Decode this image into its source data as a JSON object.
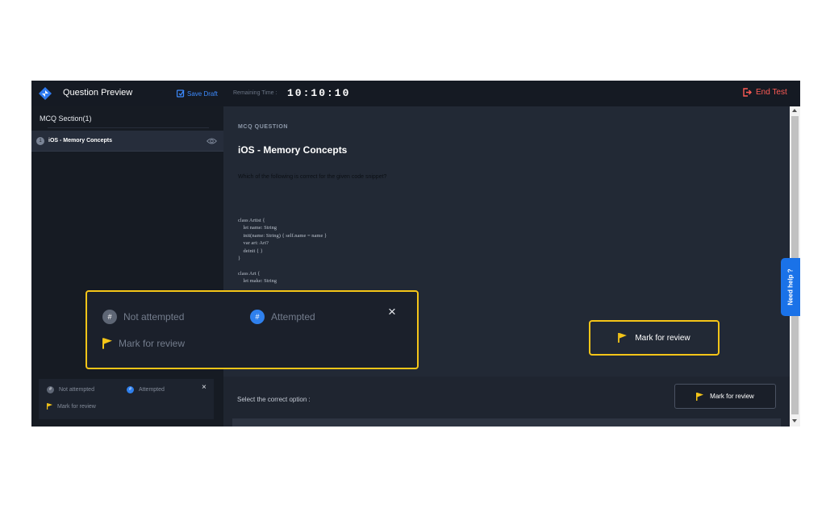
{
  "header": {
    "title": "Question Preview",
    "save_draft": "Save Draft",
    "remaining_label": "Remaining Time :",
    "timer": "10:10:10",
    "end_test": "End Test"
  },
  "sidebar": {
    "section_title": "MCQ Section(1)",
    "question": {
      "number": "1",
      "label": "iOS - Memory Concepts"
    }
  },
  "legend": {
    "not_attempted": "Not attempted",
    "attempted": "Attempted",
    "mark_for_review": "Mark for review",
    "badge_symbol": "#",
    "close": "×"
  },
  "main": {
    "question_type": "MCQ QUESTION",
    "question_title": "iOS - Memory Concepts",
    "question_text": "Which of the following is correct for the given code snippet?",
    "code_lines": [
      "class Artist {",
      "    let name: String",
      "    init(name: String) { self.name = name }",
      "    var art: Art?",
      "    deinit { }",
      "}",
      "",
      "class Art {",
      "    let make: String"
    ],
    "select_label": "Select the correct option :",
    "mark_for_review": "Mark for review"
  },
  "need_help": "Need help ?",
  "colors": {
    "accent_blue": "#3d8bff",
    "end_test_red": "#ff5b55",
    "highlight_yellow": "#f5c518",
    "not_attempted_grey": "#5e6675",
    "attempted_blue": "#2f80ed"
  },
  "icons": [
    "logo-icon",
    "save-icon",
    "logout-icon",
    "eye-icon",
    "flag-icon",
    "close-icon"
  ]
}
